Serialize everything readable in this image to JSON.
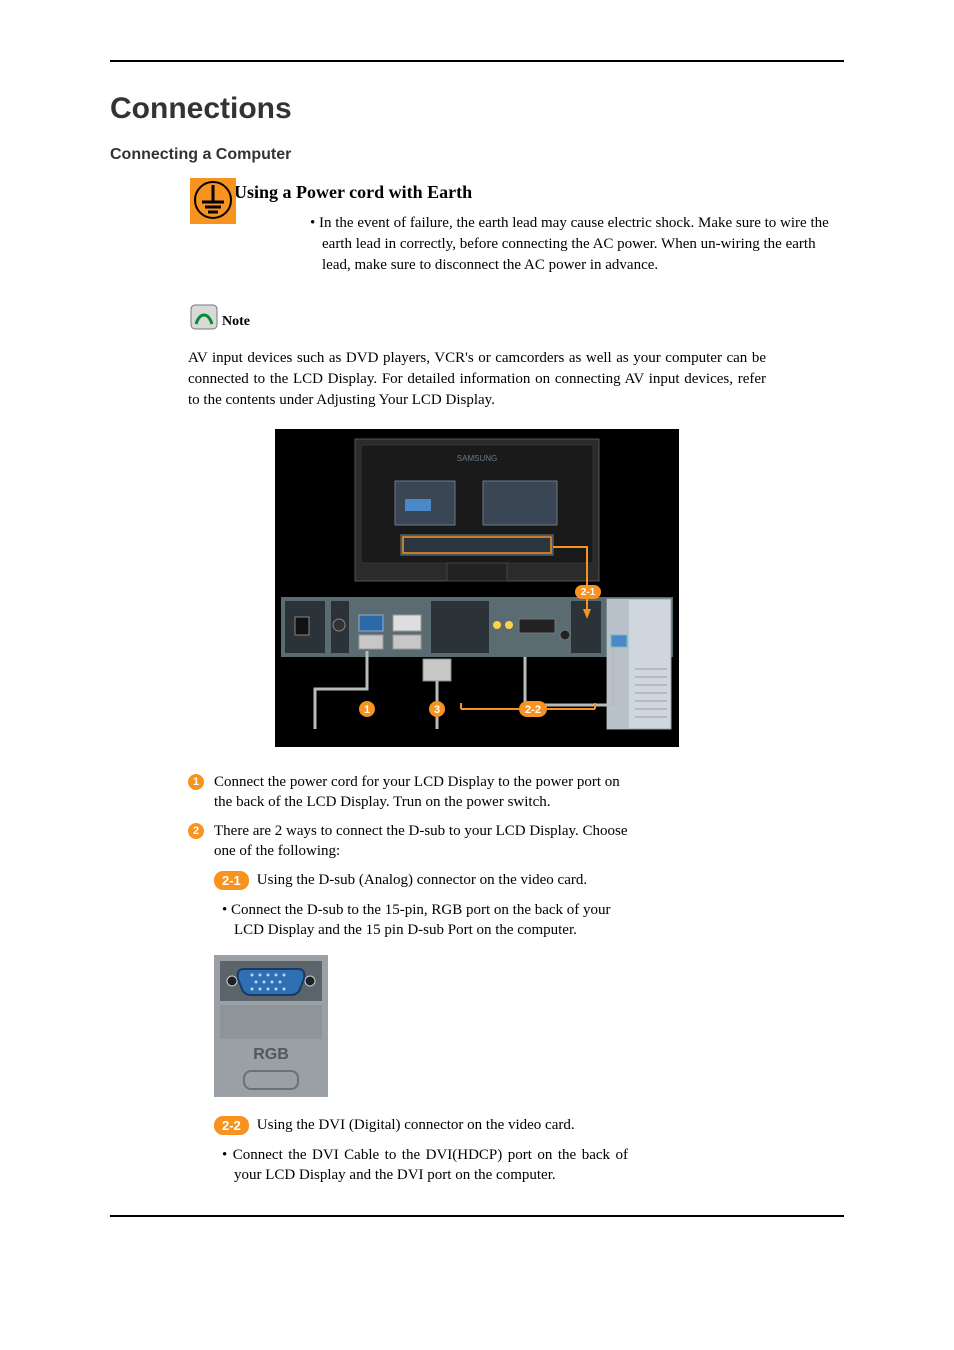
{
  "title": "Connections",
  "section_heading": "Connecting a Computer",
  "earth": {
    "heading": "Using a Power cord with Earth",
    "bullet": "In the event of failure, the earth lead may cause electric shock. Make sure to wire the earth lead in correctly, before connecting the AC power. When un-wiring the earth lead, make sure to disconnect the AC power in advance."
  },
  "note": {
    "label": "Note",
    "body": "AV input devices such as DVD players, VCR's or camcorders as well as your computer can be connected to the LCD Display. For detailed information on connecting AV input devices, refer to the contents under Adjusting Your LCD Display."
  },
  "diagram": {
    "monitor_brand": "SAMSUNG",
    "callouts": {
      "c1": "1",
      "c21": "2-1",
      "c22": "2-2",
      "c3": "3"
    },
    "rgb_label": "RGB"
  },
  "steps": {
    "s1": {
      "num": "1",
      "text": "Connect the power cord for your LCD Display to the power port on the back of the LCD Display. Trun on the power switch."
    },
    "s2": {
      "num": "2",
      "text": "There are 2 ways to connect the D-sub to your LCD Display. Choose one of the following:"
    }
  },
  "substeps": {
    "s21": {
      "badge": "2-1",
      "label": "Using the D-sub (Analog) connector on the video card.",
      "bullet": "Connect the D-sub to the 15-pin, RGB port on the back of your LCD Display and the 15 pin D-sub Port on the computer."
    },
    "s22": {
      "badge": "2-2",
      "label": "Using the DVI (Digital) connector on the video card.",
      "bullet": "Connect the DVI Cable to the DVI(HDCP) port on the back of your LCD Display and the DVI port on the computer."
    }
  }
}
